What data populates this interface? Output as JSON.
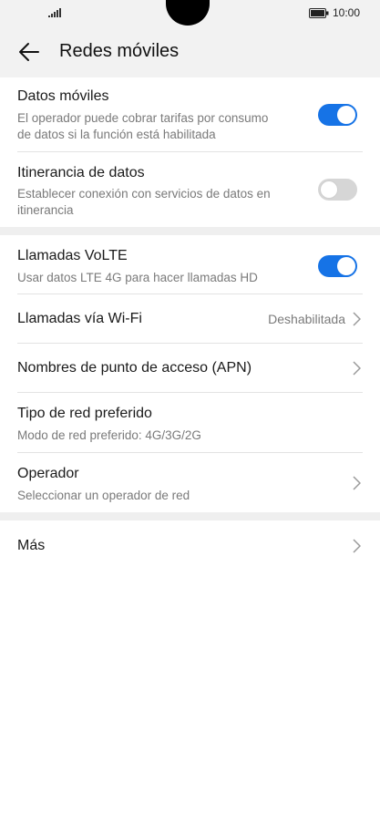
{
  "status_bar": {
    "time": "10:00"
  },
  "header": {
    "title": "Redes móviles"
  },
  "sections": {
    "datos_moviles": {
      "title": "Datos móviles",
      "subtitle_line1": "El operador puede cobrar tarifas por consumo",
      "subtitle_line2": "de datos si la función está habilitada",
      "enabled": true
    },
    "itinerancia": {
      "title": "Itinerancia de datos",
      "subtitle_line1": "Establecer conexión con servicios de datos en",
      "subtitle_line2": "itinerancia",
      "enabled": false
    },
    "volte": {
      "title": "Llamadas VoLTE",
      "subtitle": "Usar datos LTE 4G para hacer llamadas HD",
      "enabled": true
    },
    "wifi_calls": {
      "title": "Llamadas vía Wi-Fi",
      "value": "Deshabilitada"
    },
    "apn": {
      "title": "Nombres de punto de acceso (APN)"
    },
    "network_type": {
      "title": "Tipo de red preferido",
      "subtitle": "Modo de red preferido: 4G/3G/2G"
    },
    "operator": {
      "title": "Operador",
      "subtitle": "Seleccionar un operador de red"
    },
    "more": {
      "title": "Más"
    }
  },
  "colors": {
    "accent": "#1673e6",
    "toggle_off": "#d6d6d6",
    "background": "#f2f2f2",
    "card": "#ffffff",
    "secondary_text": "#7a7a7a"
  },
  "icons": {
    "back": "arrow-left-icon",
    "chevron": "chevron-right-icon",
    "signal": "signal-icon",
    "battery": "battery-icon"
  }
}
